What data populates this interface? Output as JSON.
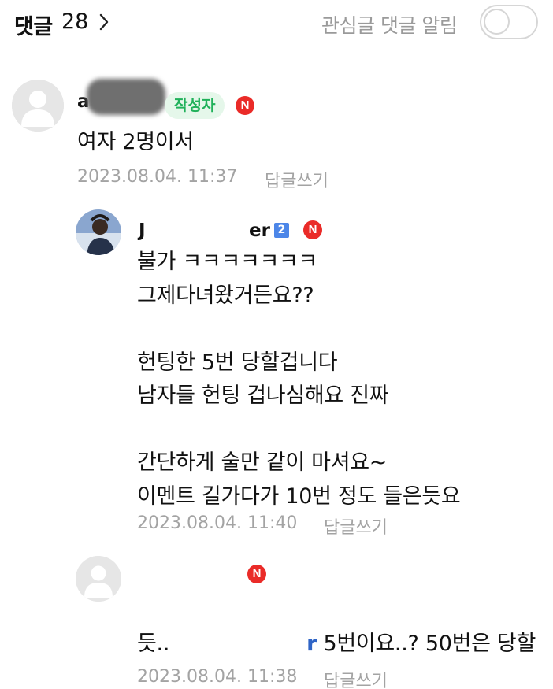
{
  "header": {
    "title": "댓글",
    "count": "28",
    "notify_label": "관심글 댓글 알림",
    "notify_on": false
  },
  "comments": [
    {
      "name_visible": "a",
      "author_badge": "작성자",
      "n_badge": "N",
      "text": "여자 2명이서",
      "date": "2023.08.04. 11:37",
      "reply_label": "답글쓰기"
    },
    {
      "name_start": "J",
      "name_end": "er",
      "level": "2",
      "n_badge": "N",
      "text": "불가 ㅋㅋㅋㅋㅋㅋㅋ\n그제다녀왔거든요??\n\n헌팅한 5번 당할겁니다\n남자들 헌팅 겁나심해요 진짜\n\n간단하게 술만 같이 마셔요~\n이멘트 길가다가 10번 정도 들은듯요",
      "date": "2023.08.04. 11:40",
      "reply_label": "답글쓰기"
    },
    {
      "n_badge": "N",
      "mention_visible": "r",
      "text_line1": " 5번이요..? 50번은 당할",
      "text_line2": "듯..",
      "date": "2023.08.04. 11:38",
      "reply_label": "답글쓰기"
    }
  ]
}
